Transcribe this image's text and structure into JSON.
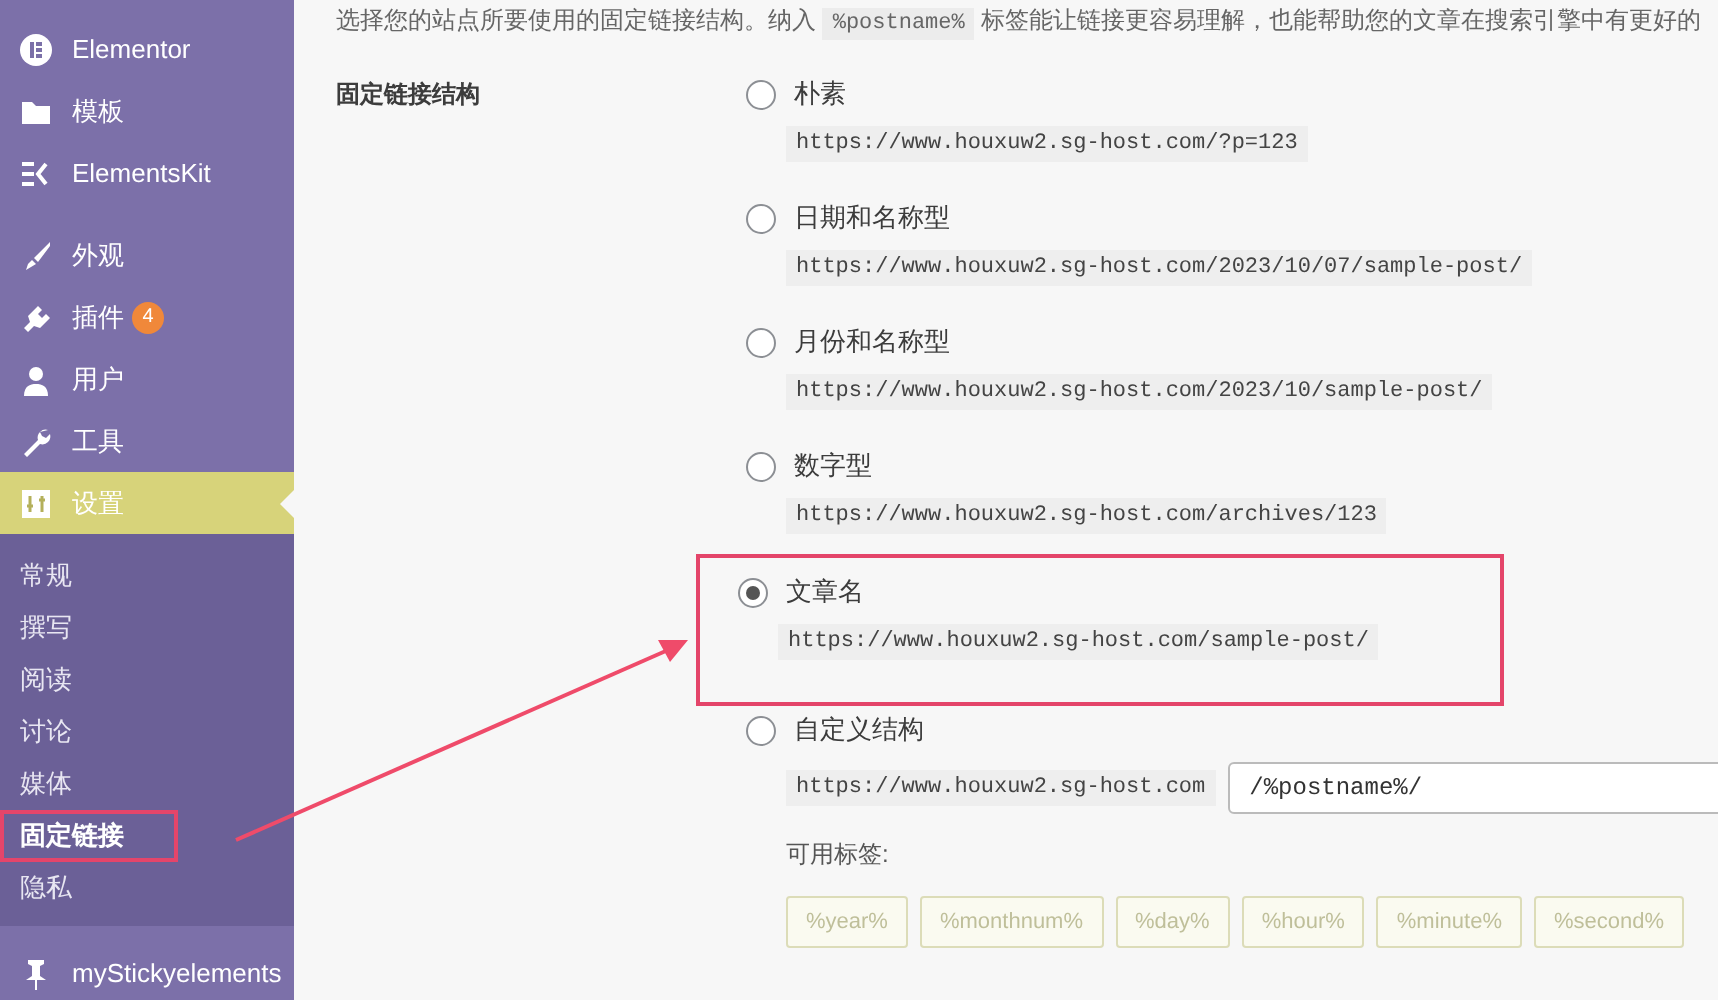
{
  "sidebar": {
    "items": [
      {
        "label": "Elementor",
        "selected": false
      },
      {
        "label": "模板",
        "selected": false
      },
      {
        "label": "ElementsKit",
        "selected": false
      },
      {
        "label": "外观",
        "selected": false
      },
      {
        "label": "插件",
        "selected": false,
        "badge": "4"
      },
      {
        "label": "用户",
        "selected": false
      },
      {
        "label": "工具",
        "selected": false
      },
      {
        "label": "设置",
        "selected": true,
        "children": [
          {
            "label": "常规",
            "selected": false
          },
          {
            "label": "撰写",
            "selected": false
          },
          {
            "label": "阅读",
            "selected": false
          },
          {
            "label": "讨论",
            "selected": false
          },
          {
            "label": "媒体",
            "selected": false
          },
          {
            "label": "固定链接",
            "selected": true
          },
          {
            "label": "隐私",
            "selected": false
          }
        ]
      },
      {
        "label": "myStickyelements",
        "selected": false
      }
    ]
  },
  "intro": {
    "before": "选择您的站点所要使用的固定链接结构。纳入",
    "code": "%postname%",
    "after": "标签能让链接更容易理解，也能帮助您的文章在搜索引擎中有更好的"
  },
  "form": {
    "label": "固定链接结构",
    "options": [
      {
        "label": "朴素",
        "url": "https://www.houxuw2.sg-host.com/?p=123",
        "selected": false
      },
      {
        "label": "日期和名称型",
        "url": "https://www.houxuw2.sg-host.com/2023/10/07/sample-post/",
        "selected": false
      },
      {
        "label": "月份和名称型",
        "url": "https://www.houxuw2.sg-host.com/2023/10/sample-post/",
        "selected": false
      },
      {
        "label": "数字型",
        "url": "https://www.houxuw2.sg-host.com/archives/123",
        "selected": false
      },
      {
        "label": "文章名",
        "url": "https://www.houxuw2.sg-host.com/sample-post/",
        "selected": true
      }
    ],
    "custom": {
      "label": "自定义结构",
      "selected": false,
      "prefix": "https://www.houxuw2.sg-host.com",
      "value": "/%postname%/",
      "tags_label": "可用标签:",
      "tags": [
        "%year%",
        "%monthnum%",
        "%day%",
        "%hour%",
        "%minute%",
        "%second%"
      ]
    }
  }
}
